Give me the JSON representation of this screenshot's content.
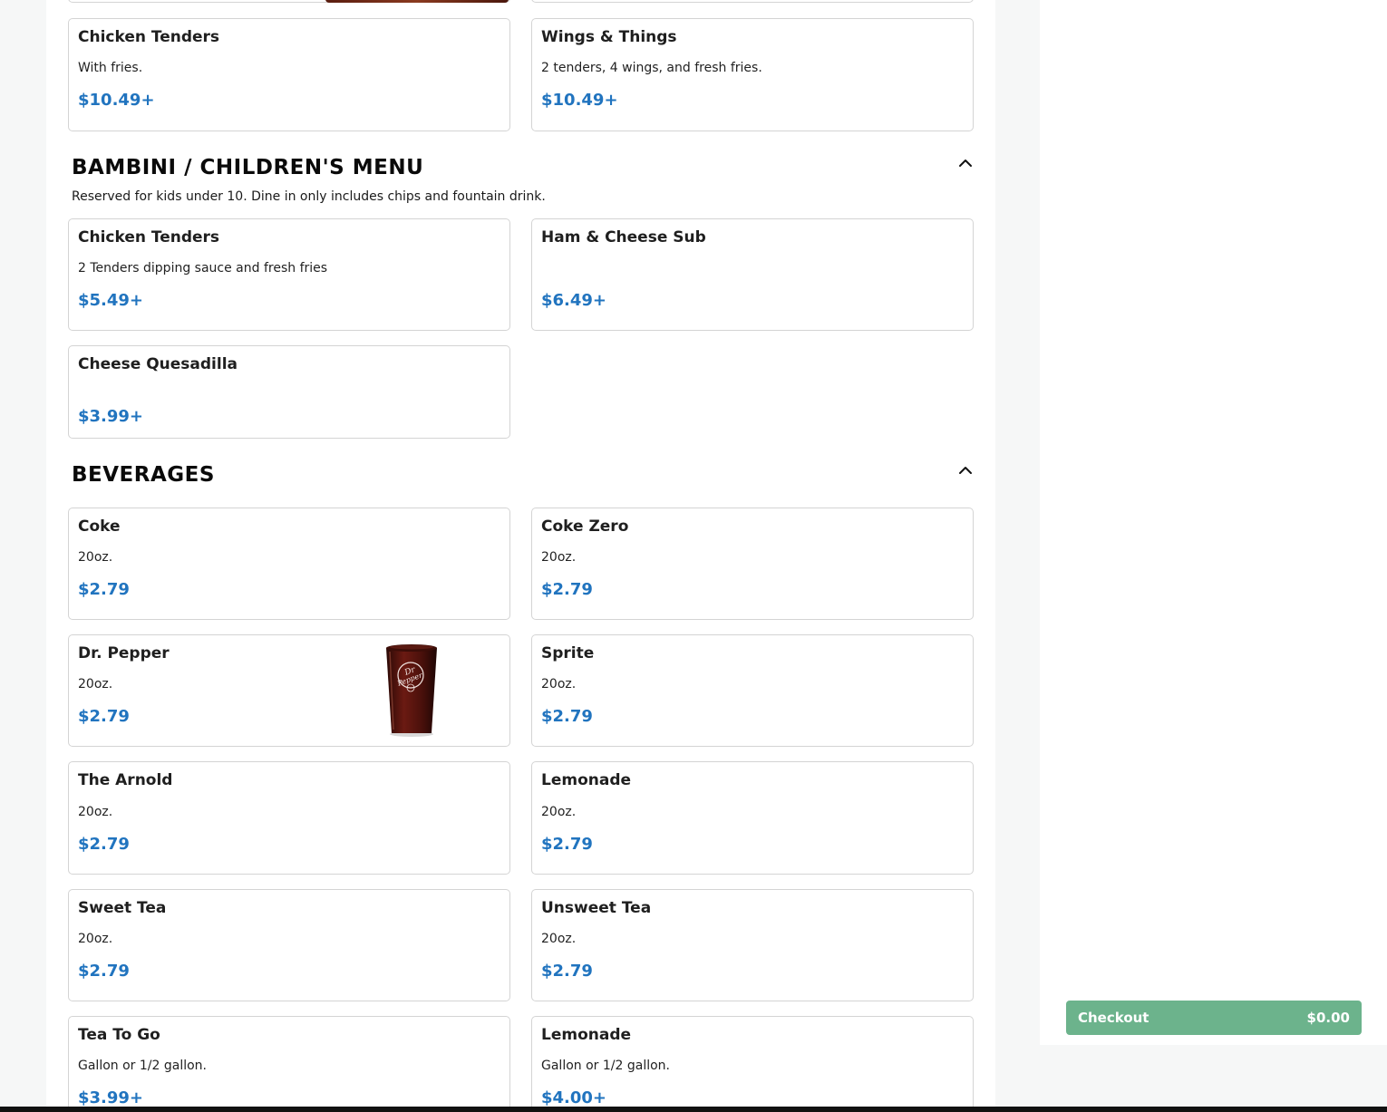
{
  "sections": {
    "bambini": {
      "title": "BAMBINI / CHILDREN'S MENU",
      "description": "Reserved for kids under 10. Dine in only includes chips and fountain drink."
    },
    "beverages": {
      "title": "BEVERAGES"
    }
  },
  "items": {
    "chicken_tenders_main": {
      "name": "Chicken Tenders",
      "desc": "With fries.",
      "price": "$10.49+"
    },
    "wings_things": {
      "name": "Wings & Things",
      "desc": "2 tenders, 4 wings, and fresh fries.",
      "price": "$10.49+"
    },
    "kids_chicken_tenders": {
      "name": "Chicken Tenders",
      "desc": "2 Tenders dipping sauce and fresh fries",
      "price": "$5.49+"
    },
    "ham_cheese_sub": {
      "name": "Ham & Cheese Sub",
      "desc": "",
      "price": "$6.49+"
    },
    "cheese_quesadilla": {
      "name": "Cheese Quesadilla",
      "desc": "",
      "price": "$3.99+"
    },
    "coke": {
      "name": "Coke",
      "desc": "20oz.",
      "price": "$2.79"
    },
    "coke_zero": {
      "name": "Coke Zero",
      "desc": "20oz.",
      "price": "$2.79"
    },
    "dr_pepper": {
      "name": "Dr. Pepper",
      "desc": "20oz.",
      "price": "$2.79"
    },
    "sprite": {
      "name": "Sprite",
      "desc": "20oz.",
      "price": "$2.79"
    },
    "the_arnold": {
      "name": "The Arnold",
      "desc": "20oz.",
      "price": "$2.79"
    },
    "lemonade_20": {
      "name": "Lemonade",
      "desc": "20oz.",
      "price": "$2.79"
    },
    "sweet_tea": {
      "name": "Sweet Tea",
      "desc": "20oz.",
      "price": "$2.79"
    },
    "unsweet_tea": {
      "name": "Unsweet Tea",
      "desc": "20oz.",
      "price": "$2.79"
    },
    "tea_to_go": {
      "name": "Tea To Go",
      "desc": "Gallon or 1/2 gallon.",
      "price": "$3.99+"
    },
    "lemonade_gallon": {
      "name": "Lemonade",
      "desc": "Gallon or 1/2 gallon.",
      "price": "$4.00+"
    }
  },
  "cart": {
    "checkout_label": "Checkout",
    "total": "$0.00"
  },
  "icons": {
    "collapse": "chevron-up-icon"
  },
  "colors": {
    "price": "#2174bf",
    "checkout": "#6cb38c"
  }
}
